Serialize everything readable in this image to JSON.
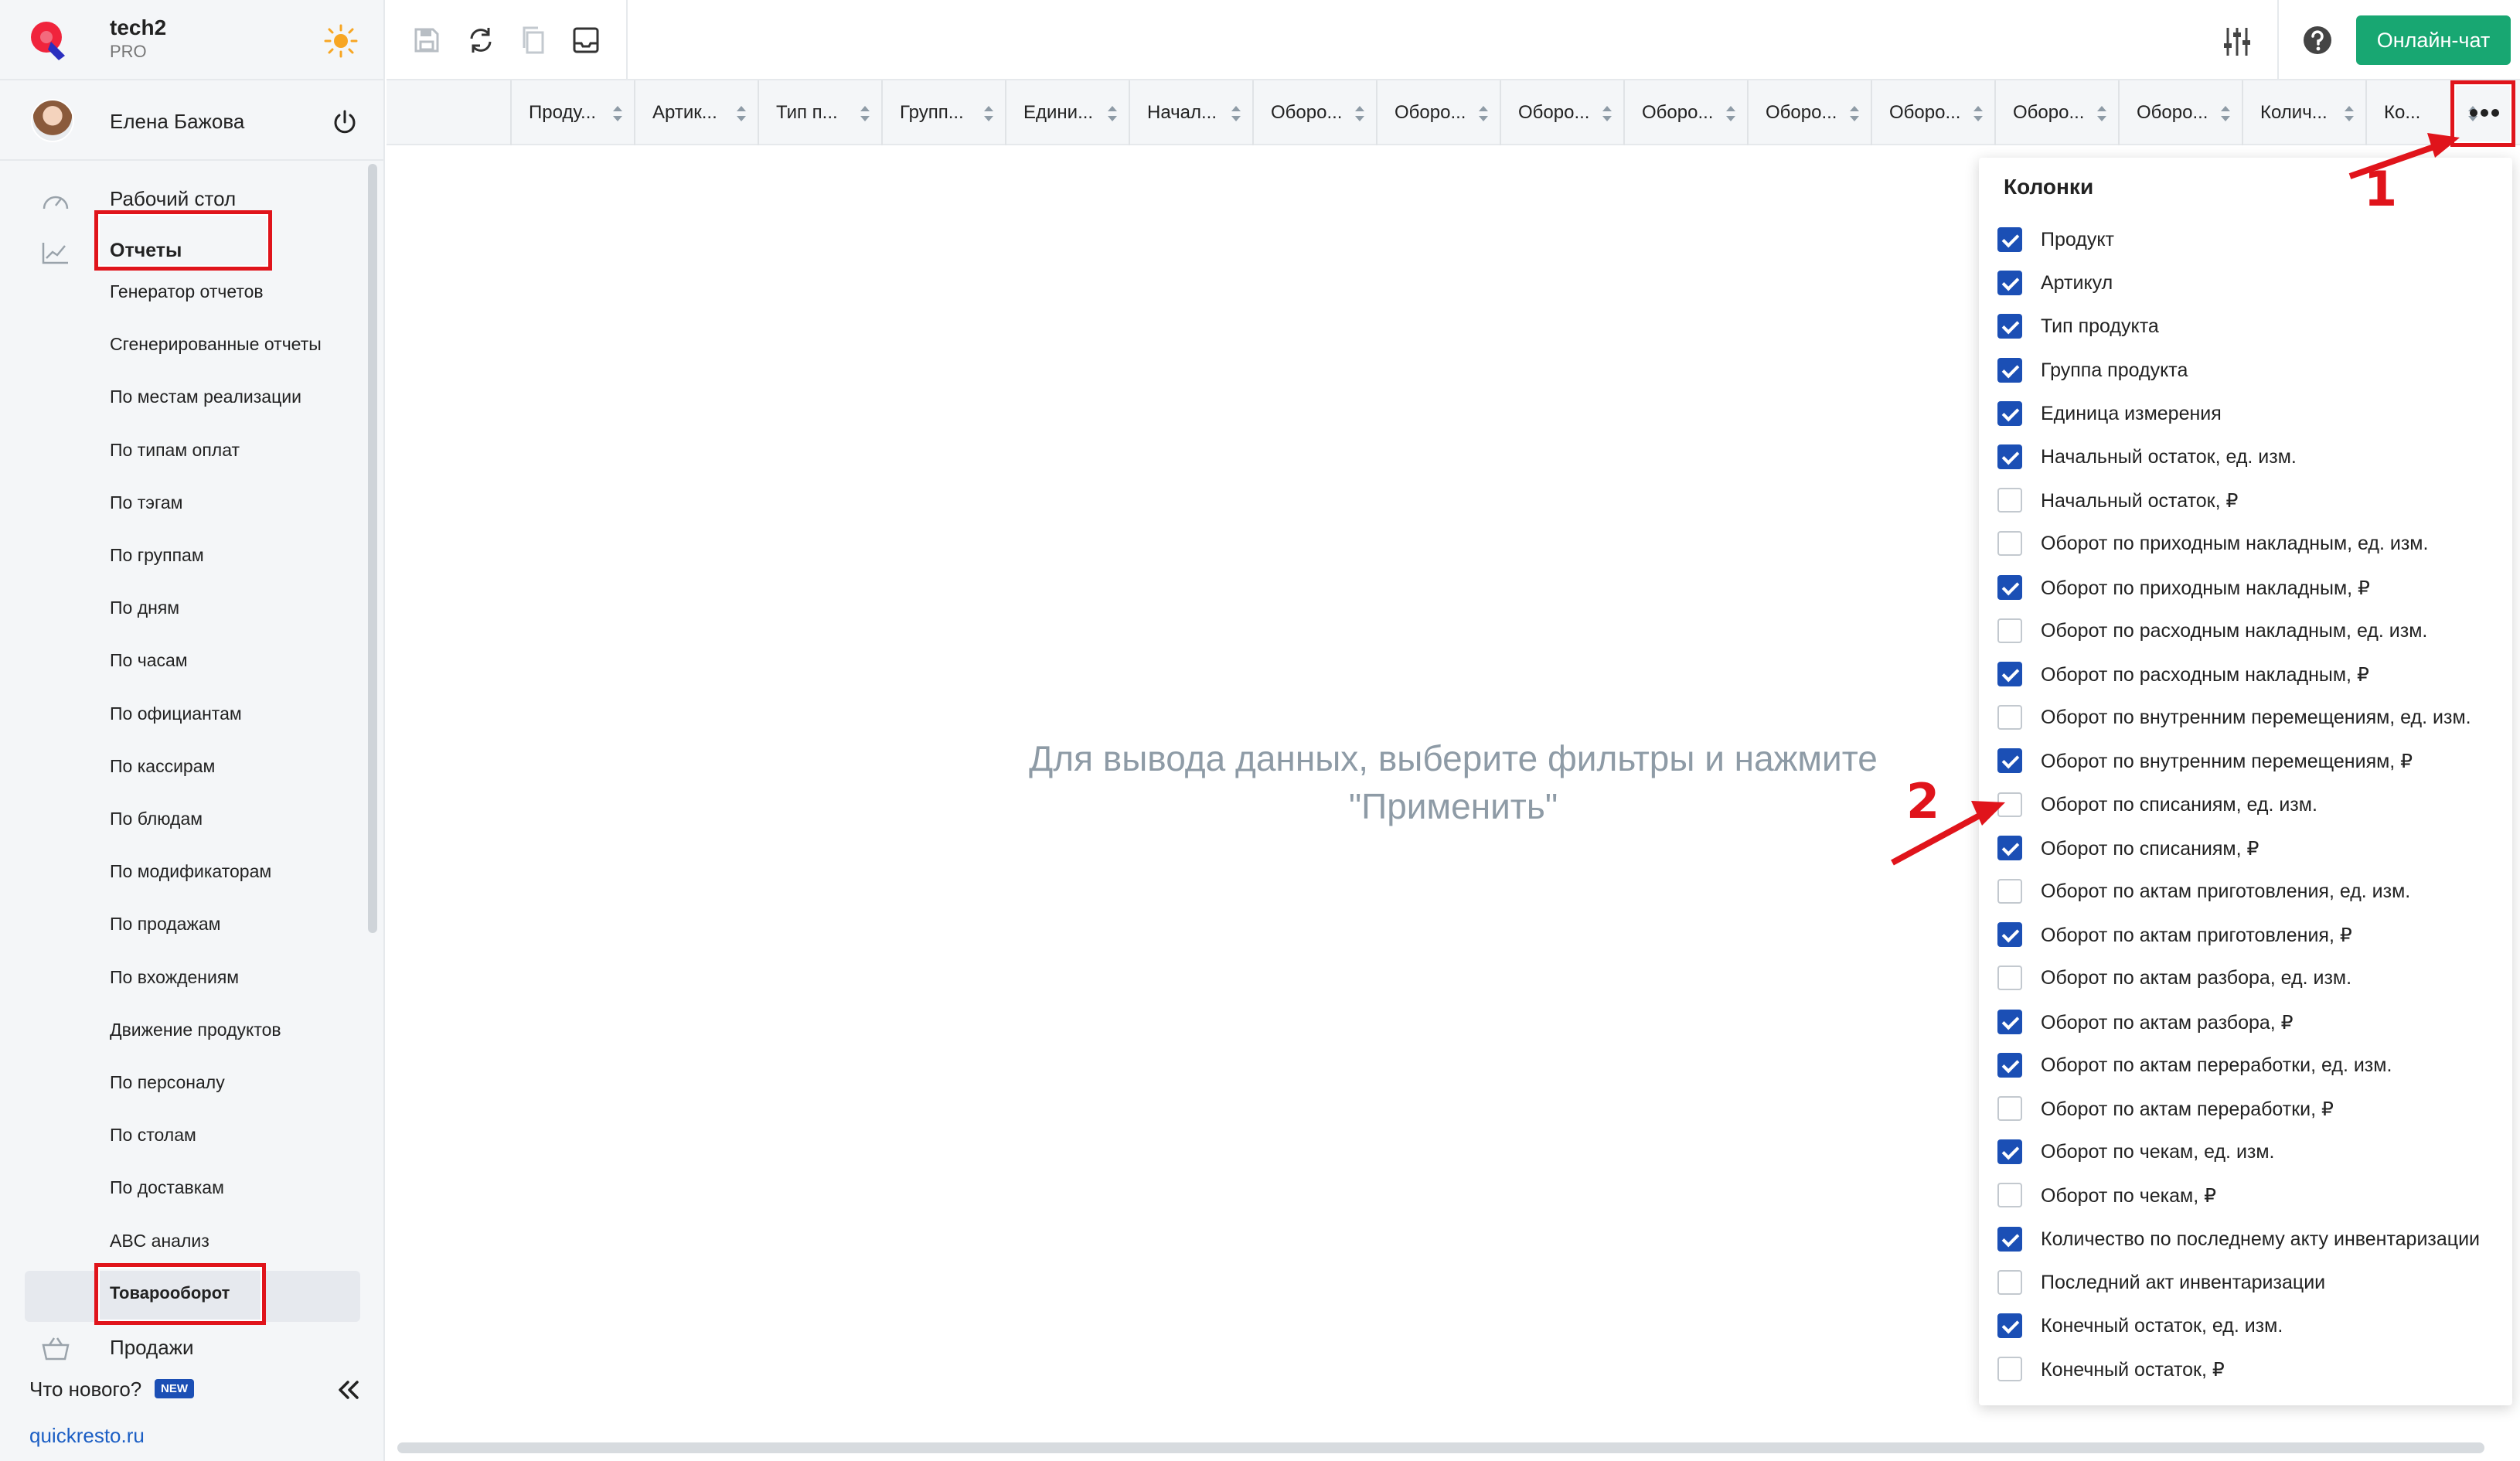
{
  "brand": {
    "name": "tech2",
    "plan": "PRO"
  },
  "user": {
    "name": "Елена Бажова"
  },
  "nav": {
    "desktop": "Рабочий стол",
    "reports": "Отчеты",
    "report_items": [
      "Генератор отчетов",
      "Сгенерированные отчеты",
      "По местам реализации",
      "По типам оплат",
      "По тэгам",
      "По группам",
      "По дням",
      "По часам",
      "По официантам",
      "По кассирам",
      "По блюдам",
      "По модификаторам",
      "По продажам",
      "По вхождениям",
      "Движение продуктов",
      "По персоналу",
      "По столам",
      "По доставкам",
      "ABC анализ",
      "Товарооборот"
    ],
    "sales": "Продажи"
  },
  "footer": {
    "whats_new": "Что нового?",
    "new_badge": "NEW",
    "site": "quickresto.ru"
  },
  "toolbar": {
    "chat": "Онлайн-чат"
  },
  "columns": [
    "Проду...",
    "Артик...",
    "Тип п...",
    "Групп...",
    "Едини...",
    "Начал...",
    "Оборо...",
    "Оборо...",
    "Оборо...",
    "Оборо...",
    "Оборо...",
    "Оборо...",
    "Оборо...",
    "Оборо...",
    "Колич...",
    "Ко..."
  ],
  "empty_message": {
    "line1": "Для вывода данных, выберите фильтры и нажмите",
    "line2": "\"Применить\""
  },
  "panel": {
    "title": "Колонки",
    "options": [
      {
        "label": "Продукт",
        "checked": true
      },
      {
        "label": "Артикул",
        "checked": true
      },
      {
        "label": "Тип продукта",
        "checked": true
      },
      {
        "label": "Группа продукта",
        "checked": true
      },
      {
        "label": "Единица измерения",
        "checked": true
      },
      {
        "label": "Начальный остаток, ед. изм.",
        "checked": true
      },
      {
        "label": "Начальный остаток, ₽",
        "checked": false
      },
      {
        "label": "Оборот по приходным накладным, ед. изм.",
        "checked": false
      },
      {
        "label": "Оборот по приходным накладным, ₽",
        "checked": true
      },
      {
        "label": "Оборот по расходным накладным, ед. изм.",
        "checked": false
      },
      {
        "label": "Оборот по расходным накладным, ₽",
        "checked": true
      },
      {
        "label": "Оборот по внутренним перемещениям, ед. изм.",
        "checked": false
      },
      {
        "label": "Оборот по внутренним перемещениям, ₽",
        "checked": true
      },
      {
        "label": "Оборот по списаниям, ед. изм.",
        "checked": false
      },
      {
        "label": "Оборот по списаниям, ₽",
        "checked": true
      },
      {
        "label": "Оборот по актам приготовления, ед. изм.",
        "checked": false
      },
      {
        "label": "Оборот по актам приготовления, ₽",
        "checked": true
      },
      {
        "label": "Оборот по актам разбора, ед. изм.",
        "checked": false
      },
      {
        "label": "Оборот по актам разбора, ₽",
        "checked": true
      },
      {
        "label": "Оборот по актам переработки, ед. изм.",
        "checked": true
      },
      {
        "label": "Оборот по актам переработки, ₽",
        "checked": false
      },
      {
        "label": "Оборот по чекам, ед. изм.",
        "checked": true
      },
      {
        "label": "Оборот по чекам, ₽",
        "checked": false
      },
      {
        "label": "Количество по последнему акту инвентаризации",
        "checked": true
      },
      {
        "label": "Последний акт инвентаризации",
        "checked": false
      },
      {
        "label": "Конечный остаток, ед. изм.",
        "checked": true
      },
      {
        "label": "Конечный остаток, ₽",
        "checked": false
      }
    ]
  },
  "annotations": {
    "step1": "1",
    "step2": "2"
  },
  "colors": {
    "accent": "#1b4fb5",
    "chat_green": "#18a772",
    "highlight_red": "#e0141b"
  }
}
